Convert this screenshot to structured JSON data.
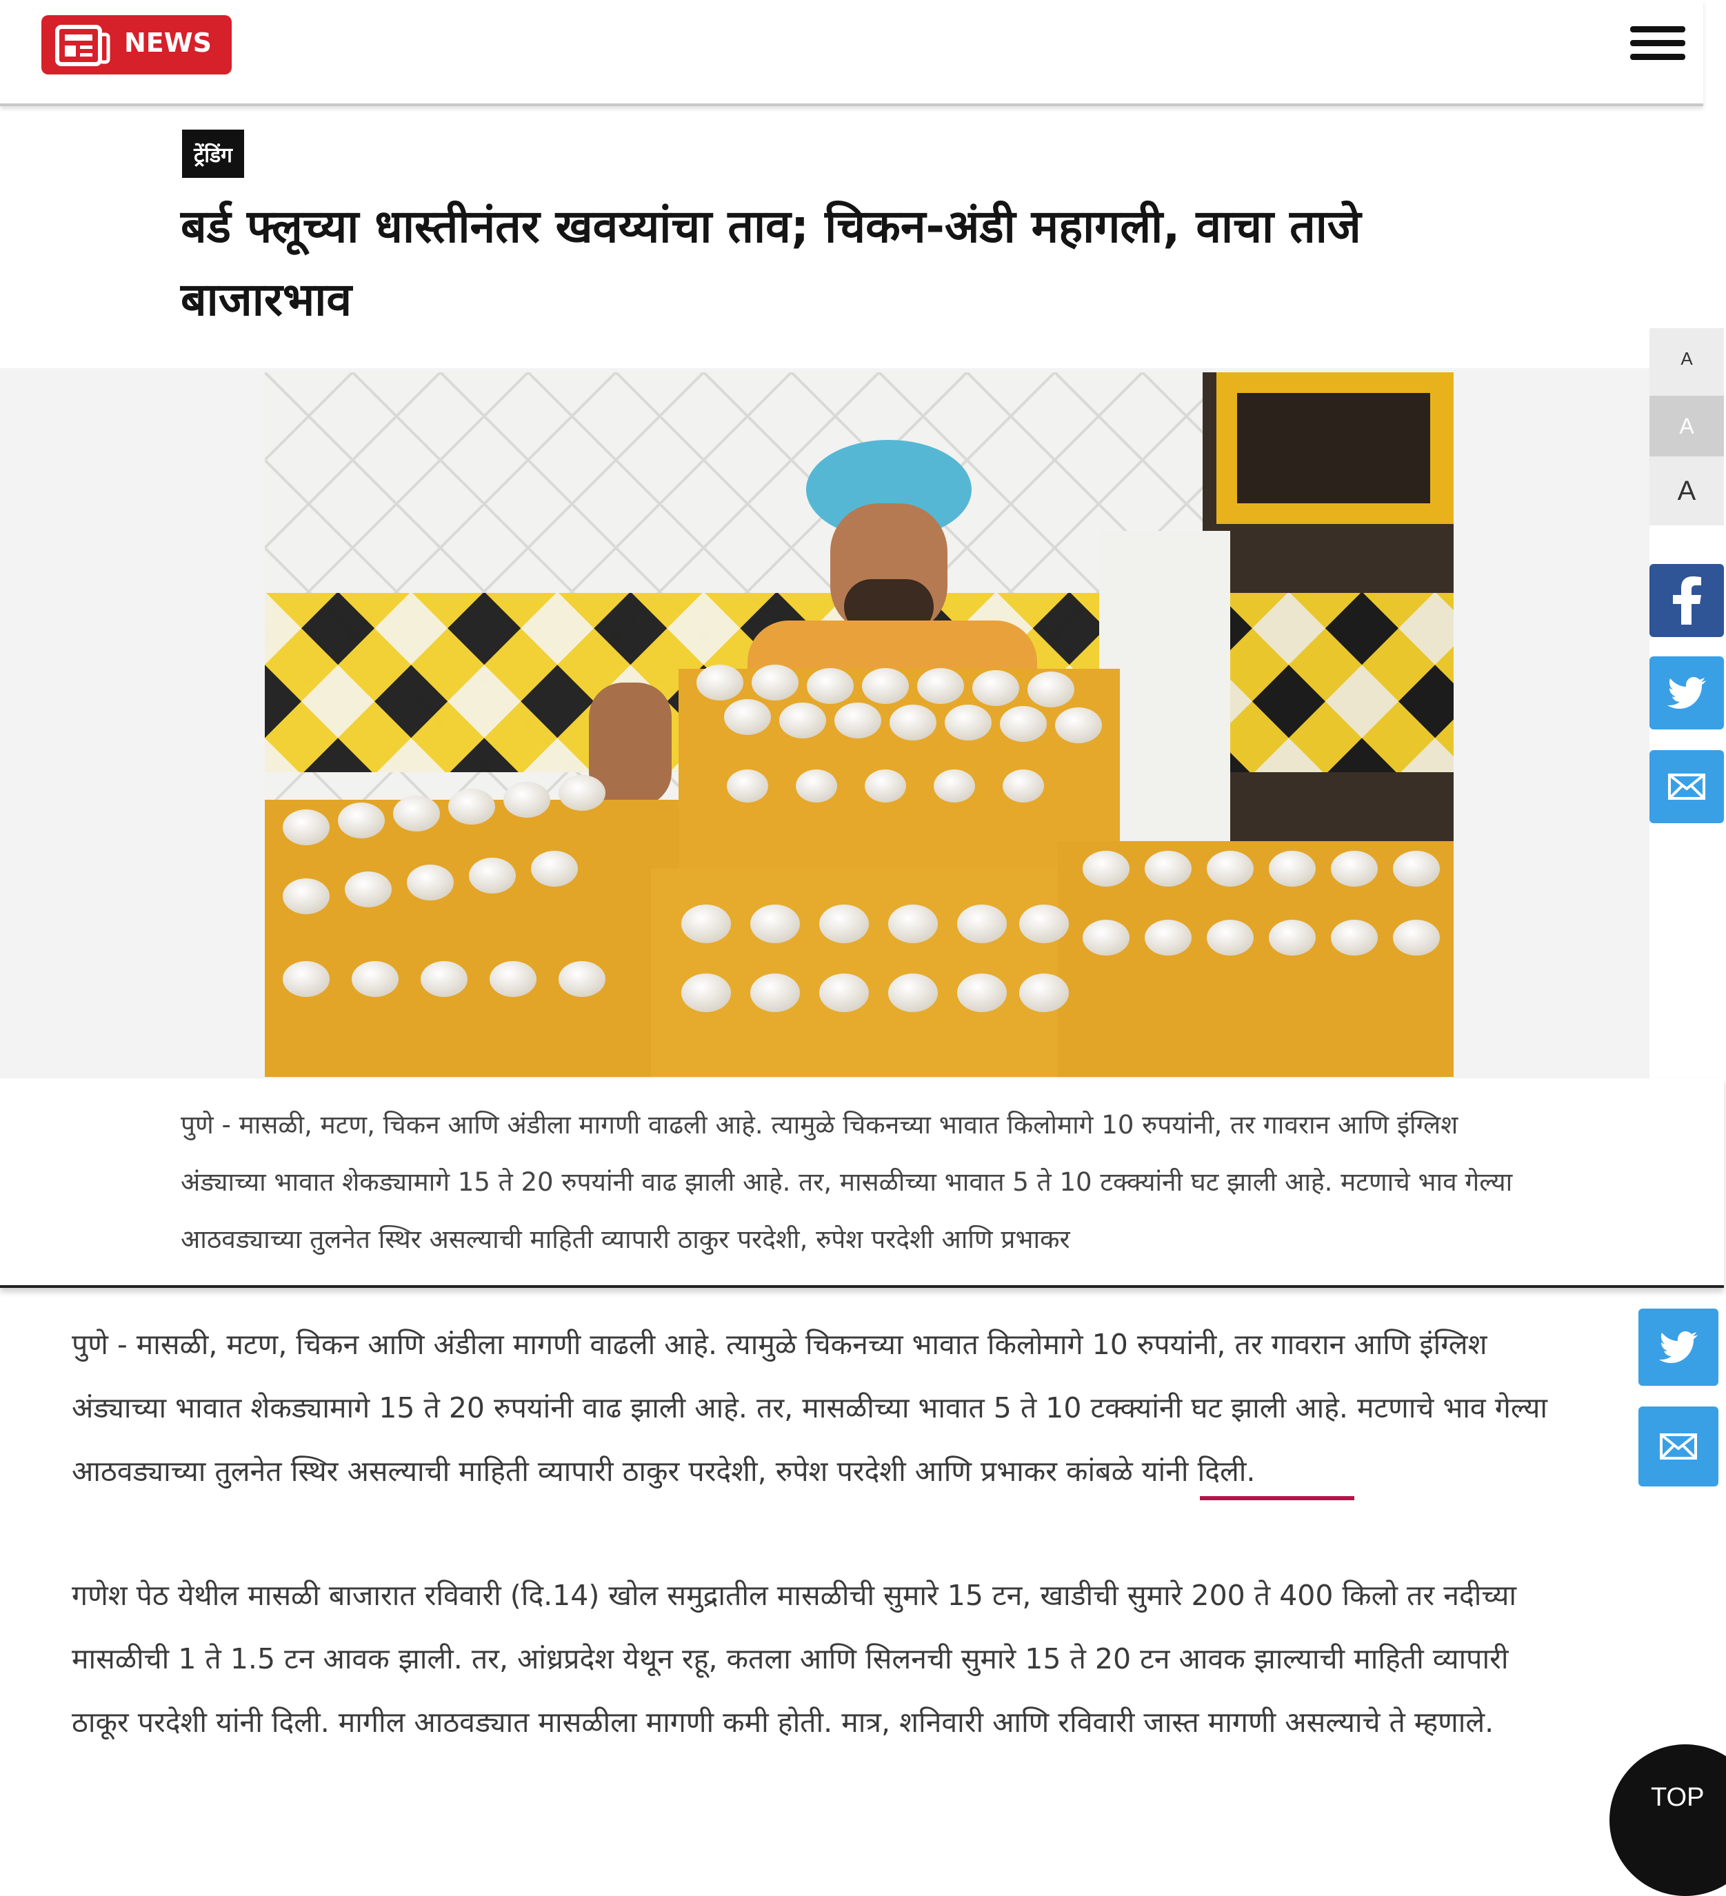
{
  "header": {
    "logo_text": "NEWS",
    "brand_color": "#d6202a",
    "menu_icon": "hamburger-icon"
  },
  "article": {
    "tag": "ट्रेंडिंग",
    "headline": "बर्ड फ्लूच्या धास्तीनंतर खवय्यांचा ताव; चिकन-अंडी महागली, वाचा ताजे बाजारभाव",
    "photo_icon": "eggs-vendor-photo"
  },
  "font_size": {
    "small": "A",
    "medium": "A",
    "large": "A"
  },
  "share": {
    "facebook_icon": "facebook-icon",
    "twitter_icon": "twitter-icon",
    "email_icon": "mail-icon",
    "facebook_color": "#2f5597",
    "twitter_color": "#3aa0e6"
  },
  "panel1": {
    "paragraph": "पुणे - मासळी, मटण, चिकन आणि अंडीला मागणी वाढली आहे. त्यामुळे चिकनच्या भावात किलोमागे 10 रुपयांनी, तर गावरान आणि इंग्लिश अंड्याच्या भावात शेकड्यामागे 15 ते 20 रुपयांनी वाढ झाली आहे. तर, मासळीच्या भावात 5 ते 10 टक्क्यांनी घट झाली आहे. मटणाचे भाव गेल्या आठवड्याच्या तुलनेत स्थिर असल्याची माहिती व्यापारी ठाकुर परदेशी, रुपेश परदेशी आणि प्रभाकर"
  },
  "panel2": {
    "para1": "पुणे - मासळी, मटण, चिकन आणि अंडीला मागणी वाढली आहे. त्यामुळे चिकनच्या भावात किलोमागे 10 रुपयांनी, तर गावरान आणि इंग्लिश अंड्याच्या भावात शेकड्यामागे 15 ते 20 रुपयांनी वाढ झाली आहे. तर, मासळीच्या भावात 5 ते 10 टक्क्यांनी घट झाली आहे. मटणाचे भाव गेल्या आठवड्याच्या तुलनेत स्थिर असल्याची माहिती व्यापारी ठाकुर परदेशी, रुपेश परदेशी आणि प्रभाकर कांबळे यांनी दिली.",
    "para2": "गणेश पेठ येथील मासळी बाजारात रविवारी (दि.14) खोल समुद्रातील मासळीची सुमारे 15 टन, खाडीची सुमारे 200 ते 400 किलो तर नदीच्या मासळीची 1 ते 1.5 टन आवक झाली. तर, आंध्रप्रदेश येथून रहू, कतला आणि सिलनची सुमारे 15 ते 20 टन आवक झाल्याची माहिती व्यापारी ठाकूर परदेशी यांनी दिली. मागील आठवड्यात मासळीला मागणी कमी होती. मात्र, शनिवारी आणि रविवारी जास्त मागणी असल्याचे ते म्हणाले."
  },
  "top_button": "TOP"
}
